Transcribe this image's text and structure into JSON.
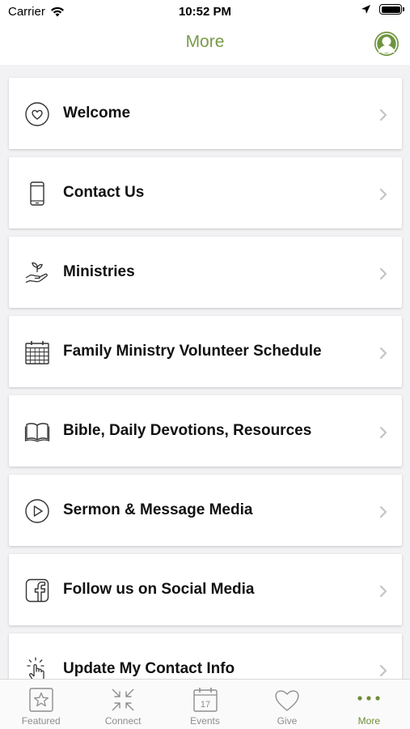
{
  "status_bar": {
    "carrier": "Carrier",
    "time": "10:52 PM"
  },
  "nav": {
    "title": "More"
  },
  "menu_items": [
    {
      "label": "Welcome",
      "icon": "heart-circle-icon"
    },
    {
      "label": "Contact Us",
      "icon": "phone-icon"
    },
    {
      "label": "Ministries",
      "icon": "hand-plant-icon"
    },
    {
      "label": "Family Ministry Volunteer Schedule",
      "icon": "calendar-grid-icon"
    },
    {
      "label": "Bible, Daily Devotions, Resources",
      "icon": "book-icon"
    },
    {
      "label": "Sermon & Message Media",
      "icon": "play-circle-icon"
    },
    {
      "label": "Follow us on Social Media",
      "icon": "facebook-icon"
    },
    {
      "label": "Update My Contact Info",
      "icon": "tap-hand-icon"
    }
  ],
  "tabs": [
    {
      "label": "Featured",
      "icon": "star-box-icon"
    },
    {
      "label": "Connect",
      "icon": "arrows-in-icon"
    },
    {
      "label": "Events",
      "icon": "calendar-icon",
      "icon_text": "17"
    },
    {
      "label": "Give",
      "icon": "heart-icon"
    },
    {
      "label": "More",
      "icon": "more-dots-icon",
      "active": true
    }
  ],
  "colors": {
    "accent": "#7a9a4a",
    "tab_active": "#6f8c3a",
    "tab_inactive": "#8e8e8e"
  }
}
